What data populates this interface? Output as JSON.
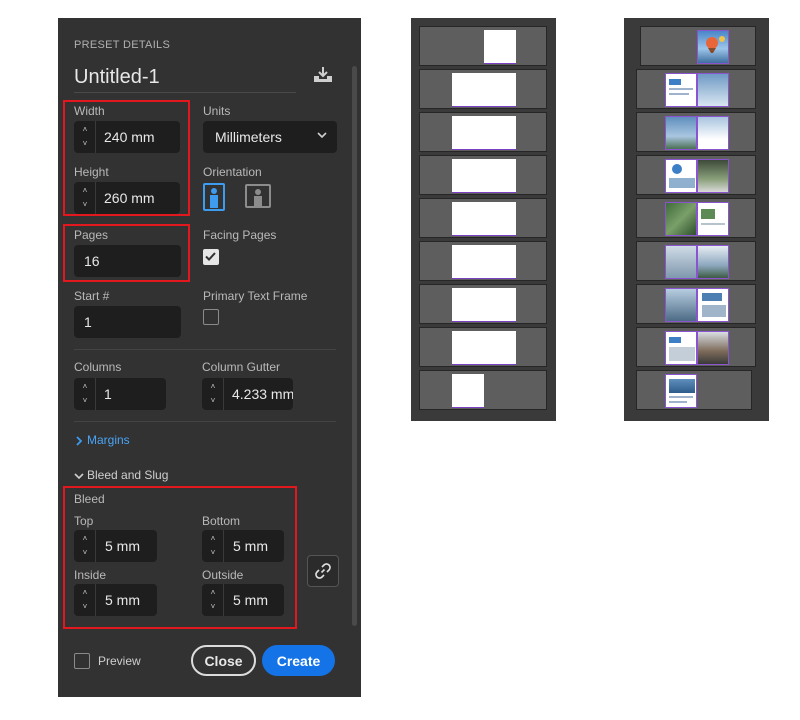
{
  "dialog": {
    "section_title": "PRESET DETAILS",
    "document_name": "Untitled-1",
    "width": {
      "label": "Width",
      "value": "240 mm"
    },
    "height": {
      "label": "Height",
      "value": "260 mm"
    },
    "units": {
      "label": "Units",
      "value": "Millimeters"
    },
    "orientation": {
      "label": "Orientation",
      "selected": "portrait"
    },
    "pages": {
      "label": "Pages",
      "value": "16"
    },
    "facing_pages": {
      "label": "Facing Pages",
      "checked": true
    },
    "start": {
      "label": "Start #",
      "value": "1"
    },
    "primary_text_frame": {
      "label": "Primary Text Frame",
      "checked": false
    },
    "columns": {
      "label": "Columns",
      "value": "1"
    },
    "column_gutter": {
      "label": "Column Gutter",
      "value": "4.233 mm"
    },
    "margins_label": "Margins",
    "bleed_slug_label": "Bleed and Slug",
    "bleed": {
      "title": "Bleed",
      "top": {
        "label": "Top",
        "value": "5 mm"
      },
      "bottom": {
        "label": "Bottom",
        "value": "5 mm"
      },
      "inside": {
        "label": "Inside",
        "value": "5 mm"
      },
      "outside": {
        "label": "Outside",
        "value": "5 mm"
      }
    },
    "preview": {
      "label": "Preview",
      "checked": false
    },
    "close_label": "Close",
    "create_label": "Create"
  },
  "colors": {
    "panel": "#323232",
    "field": "#1e1e1e",
    "accent_blue": "#1473e6",
    "highlight_red": "#e3171e",
    "page_border_purple": "#7b3fc4"
  },
  "page_panels": [
    {
      "name": "blank-pages-panel",
      "content": "blank",
      "spreads": 9
    },
    {
      "name": "filled-pages-panel",
      "content": "photos",
      "spreads": 9
    }
  ]
}
